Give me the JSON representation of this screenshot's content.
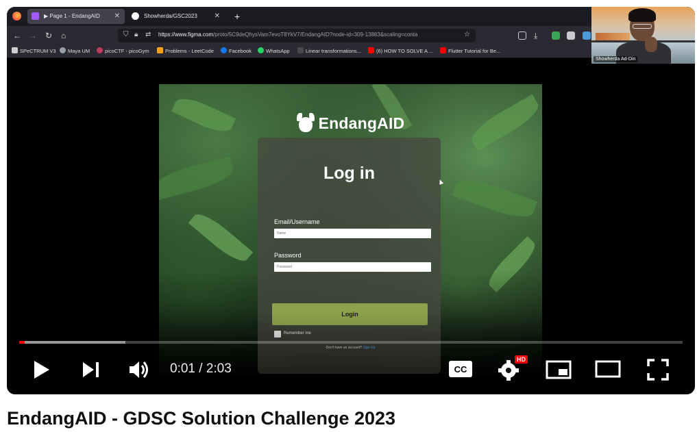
{
  "browser": {
    "tabs": [
      {
        "label": "▶ Page 1 - EndangAID",
        "favicon_color": "#a259ff"
      },
      {
        "label": "Showherda/GSC2023",
        "favicon_color": "#ffffff"
      }
    ],
    "url_domain": "https://www.figma.com",
    "url_path": "/proto/5C9deQhysVam7evoT8YkV7/EndangAID?node-id=309-13883&scaling=conta",
    "bookmarks": [
      {
        "label": "SPeCTRUM V3",
        "color": "#cccccc"
      },
      {
        "label": "Maya UM",
        "color": "#9aa0a6"
      },
      {
        "label": "picoCTF - picoGym",
        "color": "#c03b5a"
      },
      {
        "label": "Problems - LeetCode",
        "color": "#ffa116"
      },
      {
        "label": "Facebook",
        "color": "#1877f2"
      },
      {
        "label": "WhatsApp",
        "color": "#25d366"
      },
      {
        "label": "Linear transformations...",
        "color": "#4a4a4a"
      },
      {
        "label": "(6) HOW TO SOLVE A ...",
        "color": "#ff0000"
      },
      {
        "label": "Flutter Tutorial for Be...",
        "color": "#ff0000"
      }
    ]
  },
  "webcam": {
    "name": "Showherda Ad-Din"
  },
  "app": {
    "brand": "EndangAID",
    "title": "Log in",
    "email_label": "Email/Username",
    "email_placeholder": "Name",
    "password_label": "Password",
    "password_placeholder": "Password",
    "remember_label": "Remember me",
    "login_button": "Login",
    "signup_text": "Don't have an account?",
    "signup_link": "Sign Up"
  },
  "player": {
    "current_time": "0:01",
    "duration": "2:03",
    "progress_fraction": 0.008,
    "buffered_fraction": 0.16,
    "quality_badge": "HD",
    "cc_label": "CC"
  },
  "video": {
    "title": "EndangAID - GDSC Solution Challenge 2023"
  }
}
